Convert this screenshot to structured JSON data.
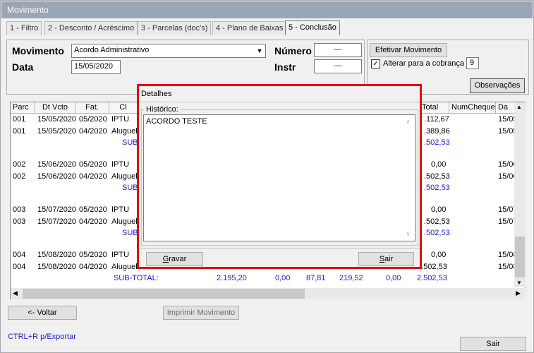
{
  "window": {
    "title": "Movimento"
  },
  "tabs": [
    {
      "label": "1 - Filtro"
    },
    {
      "label": "2 - Desconto / Acréscimo"
    },
    {
      "label": "3 - Parcelas (doc's)"
    },
    {
      "label": "4 - Plano de Baixas"
    },
    {
      "label": "5 - Conclusão"
    }
  ],
  "form": {
    "movimento_label": "Movimento",
    "movimento_value": "Acordo Administrativo",
    "data_label": "Data",
    "data_value": "15/05/2020",
    "numero_label": "Número",
    "numero_value": "—",
    "instr_label": "Instr",
    "instr_value": "—"
  },
  "actions": {
    "efetivar_label": "Efetivar Movimento",
    "alterar_label": "Alterar para a cobrança",
    "alterar_checked": "✓",
    "alterar_value": "9",
    "observacoes_label": "Observações"
  },
  "grid": {
    "headers": {
      "parc": "Parc",
      "dtvcto": "Dt Vcto",
      "fat": "Fat.",
      "cl": "Cl",
      "total": "Total",
      "numcheque": "NumCheque",
      "da": "Da"
    },
    "rows": [
      {
        "parc": "001",
        "dtvcto": "15/05/2020",
        "fat": "05/2020",
        "cl": "IPTU",
        "total": ".112,67",
        "da": "15/05"
      },
      {
        "parc": "001",
        "dtvcto": "15/05/2020",
        "fat": "04/2020",
        "cl": "Aluguel",
        "total": ".389,86",
        "da": "15/05"
      },
      {
        "sub": "SUB",
        "total": ".502,53"
      },
      {
        "parc": "002",
        "dtvcto": "15/06/2020",
        "fat": "05/2020",
        "cl": "IPTU",
        "total": "0,00",
        "da": "15/06"
      },
      {
        "parc": "002",
        "dtvcto": "15/06/2020",
        "fat": "04/2020",
        "cl": "Aluguel",
        "total": ".502,53",
        "da": "15/06"
      },
      {
        "sub": "SUB",
        "total": ".502,53"
      },
      {
        "parc": "003",
        "dtvcto": "15/07/2020",
        "fat": "05/2020",
        "cl": "IPTU",
        "total": "0,00",
        "da": "15/07"
      },
      {
        "parc": "003",
        "dtvcto": "15/07/2020",
        "fat": "04/2020",
        "cl": "Aluguel",
        "total": ".502,53",
        "da": "15/07"
      },
      {
        "sub": "SUB",
        "total": ".502,53"
      },
      {
        "parc": "004",
        "dtvcto": "15/08/2020",
        "fat": "05/2020",
        "cl": "IPTU",
        "total": "0,00",
        "da": "15/08"
      },
      {
        "parc": "004",
        "dtvcto": "15/08/2020",
        "fat": "04/2020",
        "cl": "Aluguel",
        "total": "2.502,53",
        "da": "15/08"
      }
    ],
    "subtotal": {
      "label": "SUB-TOTAL:",
      "v1": "2.195,20",
      "v2": "0,00",
      "v3": "87,81",
      "v4": "219,52",
      "v5": "0,00",
      "v6": "2.502,53"
    }
  },
  "modal": {
    "title": "Detalhes",
    "historico_label": "Histórico:",
    "historico_value": "ACORDO TESTE",
    "gravar_label": "Gravar",
    "sair_label": "Sair"
  },
  "bottom": {
    "voltar_label": "<- Voltar",
    "imprimir_label": "Imprimir Movimento",
    "export_hint": "CTRL+R p/Exportar",
    "sair_label": "Sair"
  },
  "colors": {
    "accent_red": "#e01010",
    "subtotal_blue": "#1b1bd1",
    "titlebar": "#9aa5b5"
  }
}
